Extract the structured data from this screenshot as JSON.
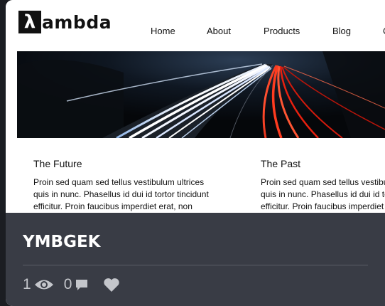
{
  "preview": {
    "logo": {
      "mark": "λ",
      "text": "ambda"
    },
    "nav": [
      "Home",
      "About",
      "Products",
      "Blog",
      "C"
    ],
    "hero_image": "highway-light-trails-photo",
    "columns": [
      {
        "title": "The Future",
        "lines": [
          "Proin sed quam sed tellus vestibulum ultrices",
          "quis in nunc. Phasellus id dui id tortor tincidunt",
          "efficitur. Proin faucibus imperdiet erat, non"
        ]
      },
      {
        "title": "The Past",
        "lines": [
          "Proin sed quam sed tellus vestibulum ultrices",
          "quis in nunc. Phasellus id dui id tortor tincidunt",
          "efficitur. Proin faucibus imperdiet erat, non"
        ]
      }
    ]
  },
  "overlay": {
    "title": "YMBGEK",
    "views": "1",
    "comments": "0",
    "icons": {
      "views": "eye-icon",
      "comments": "comment-icon",
      "like": "heart-icon"
    }
  },
  "colors": {
    "background": "#1b1d22",
    "overlay": "#393c45",
    "overlay_text": "#ffffff",
    "stat_text": "#c4c6cb"
  }
}
